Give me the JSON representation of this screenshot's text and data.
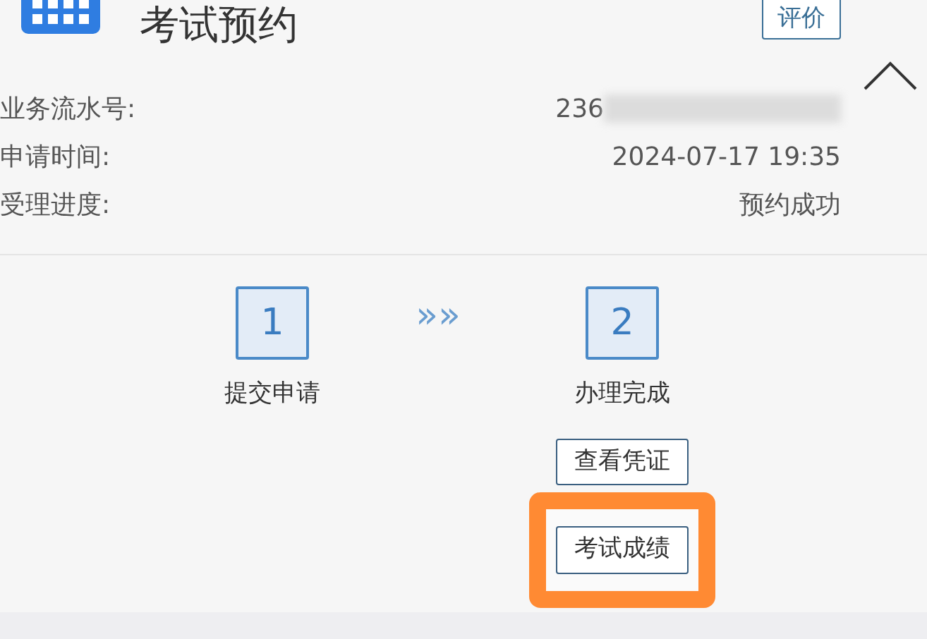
{
  "header": {
    "title": "考试预约",
    "rate_button": "评价"
  },
  "details": [
    {
      "label": "业务流水号:",
      "value": "236",
      "redacted": true
    },
    {
      "label": "申请时间:",
      "value": "2024-07-17 19:35",
      "redacted": false
    },
    {
      "label": "受理进度:",
      "value": "预约成功",
      "redacted": false
    }
  ],
  "expanded": true,
  "steps": [
    {
      "number": "1",
      "label": "提交申请"
    },
    {
      "number": "2",
      "label": "办理完成"
    }
  ],
  "step_separator": "»»",
  "actions": [
    {
      "label": "查看凭证",
      "highlighted": false
    },
    {
      "label": "考试成绩",
      "highlighted": true
    }
  ]
}
